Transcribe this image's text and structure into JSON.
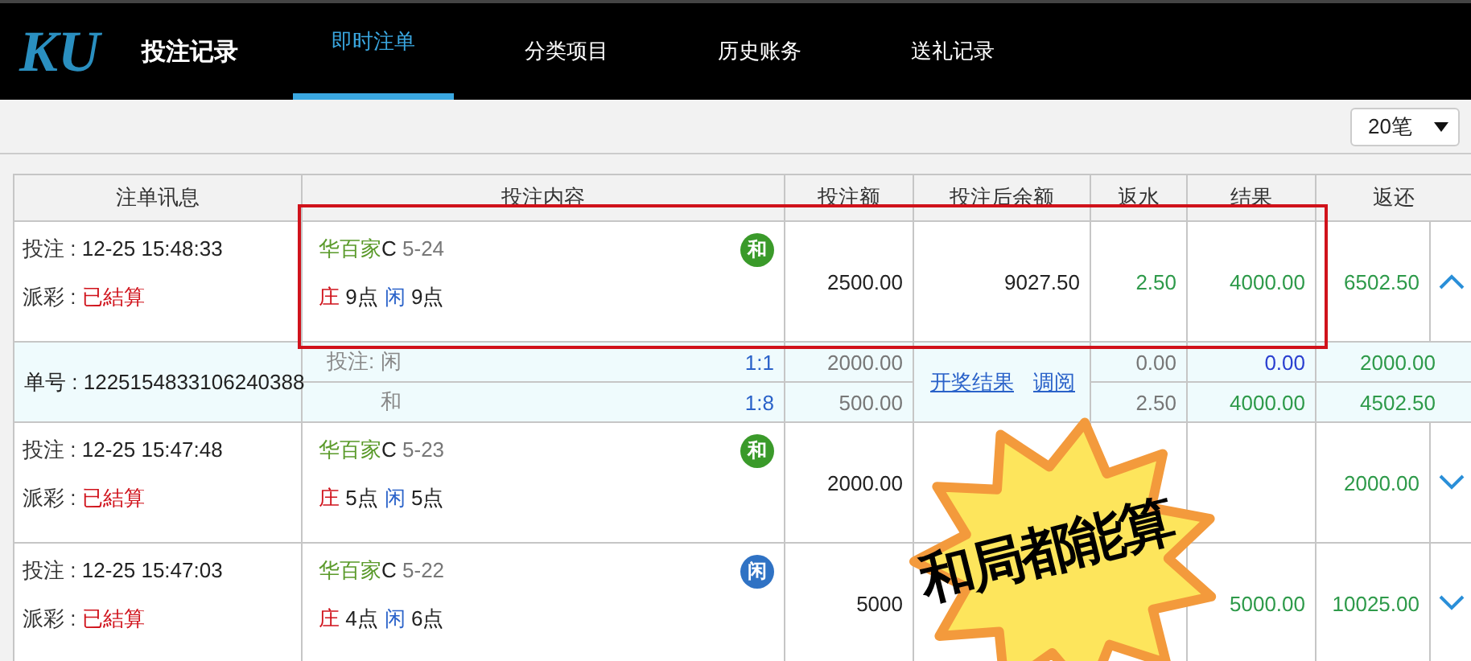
{
  "logo": "KU",
  "brand": "投注记录",
  "tabs": [
    {
      "label": "即时注单",
      "selected": true
    },
    {
      "label": "分类项目",
      "selected": false
    },
    {
      "label": "历史账务",
      "selected": false
    },
    {
      "label": "送礼记录",
      "selected": false
    }
  ],
  "page_size": "20笔",
  "table": {
    "columns": [
      "注单讯息",
      "投注内容",
      "投注额",
      "投注后余额",
      "返水",
      "结果",
      "返还"
    ],
    "rows": [
      {
        "bet_label": "投注 :",
        "bet_time": "12-25 15:48:33",
        "payout_label": "派彩 :",
        "payout_status": "已結算",
        "game": "华百家",
        "table": "C",
        "round": "5-24",
        "banker_label": "庄",
        "banker_points": "9点",
        "player_label": "闲",
        "player_points": "9点",
        "outcome": {
          "label": "和",
          "kind": "tie"
        },
        "amount": "2500.00",
        "balance": "9027.50",
        "rebate": "2.50",
        "result": "4000.00",
        "return": "6502.50",
        "expanded": true,
        "details": {
          "order_label": "单号 :",
          "order_no": "1225154833106240388",
          "bet_label": "投注:",
          "links": [
            "开奖结果",
            "调阅"
          ],
          "lines": [
            {
              "pick": "闲",
              "odds": "1:1",
              "amount": "2000.00",
              "rebate": "0.00",
              "result": "0.00",
              "won": false,
              "return": "2000.00"
            },
            {
              "pick": "和",
              "odds": "1:8",
              "amount": "500.00",
              "rebate": "2.50",
              "result": "4000.00",
              "won": true,
              "return": "4502.50"
            }
          ]
        }
      },
      {
        "bet_label": "投注 :",
        "bet_time": "12-25 15:47:48",
        "payout_label": "派彩 :",
        "payout_status": "已結算",
        "game": "华百家",
        "table": "C",
        "round": "5-23",
        "banker_label": "庄",
        "banker_points": "5点",
        "player_label": "闲",
        "player_points": "5点",
        "outcome": {
          "label": "和",
          "kind": "tie"
        },
        "amount": "2000.00",
        "return": "2000.00",
        "expanded": false
      },
      {
        "bet_label": "投注 :",
        "bet_time": "12-25 15:47:03",
        "payout_label": "派彩 :",
        "payout_status": "已結算",
        "game": "华百家",
        "table": "C",
        "round": "5-22",
        "banker_label": "庄",
        "banker_points": "4点",
        "player_label": "闲",
        "player_points": "6点",
        "outcome": {
          "label": "闲",
          "kind": "player"
        },
        "amount": "5000",
        "result": "5000.00",
        "return": "10025.00",
        "expanded": false
      }
    ]
  },
  "highlight_frame": true,
  "sticker": {
    "text": "和局都能算"
  }
}
